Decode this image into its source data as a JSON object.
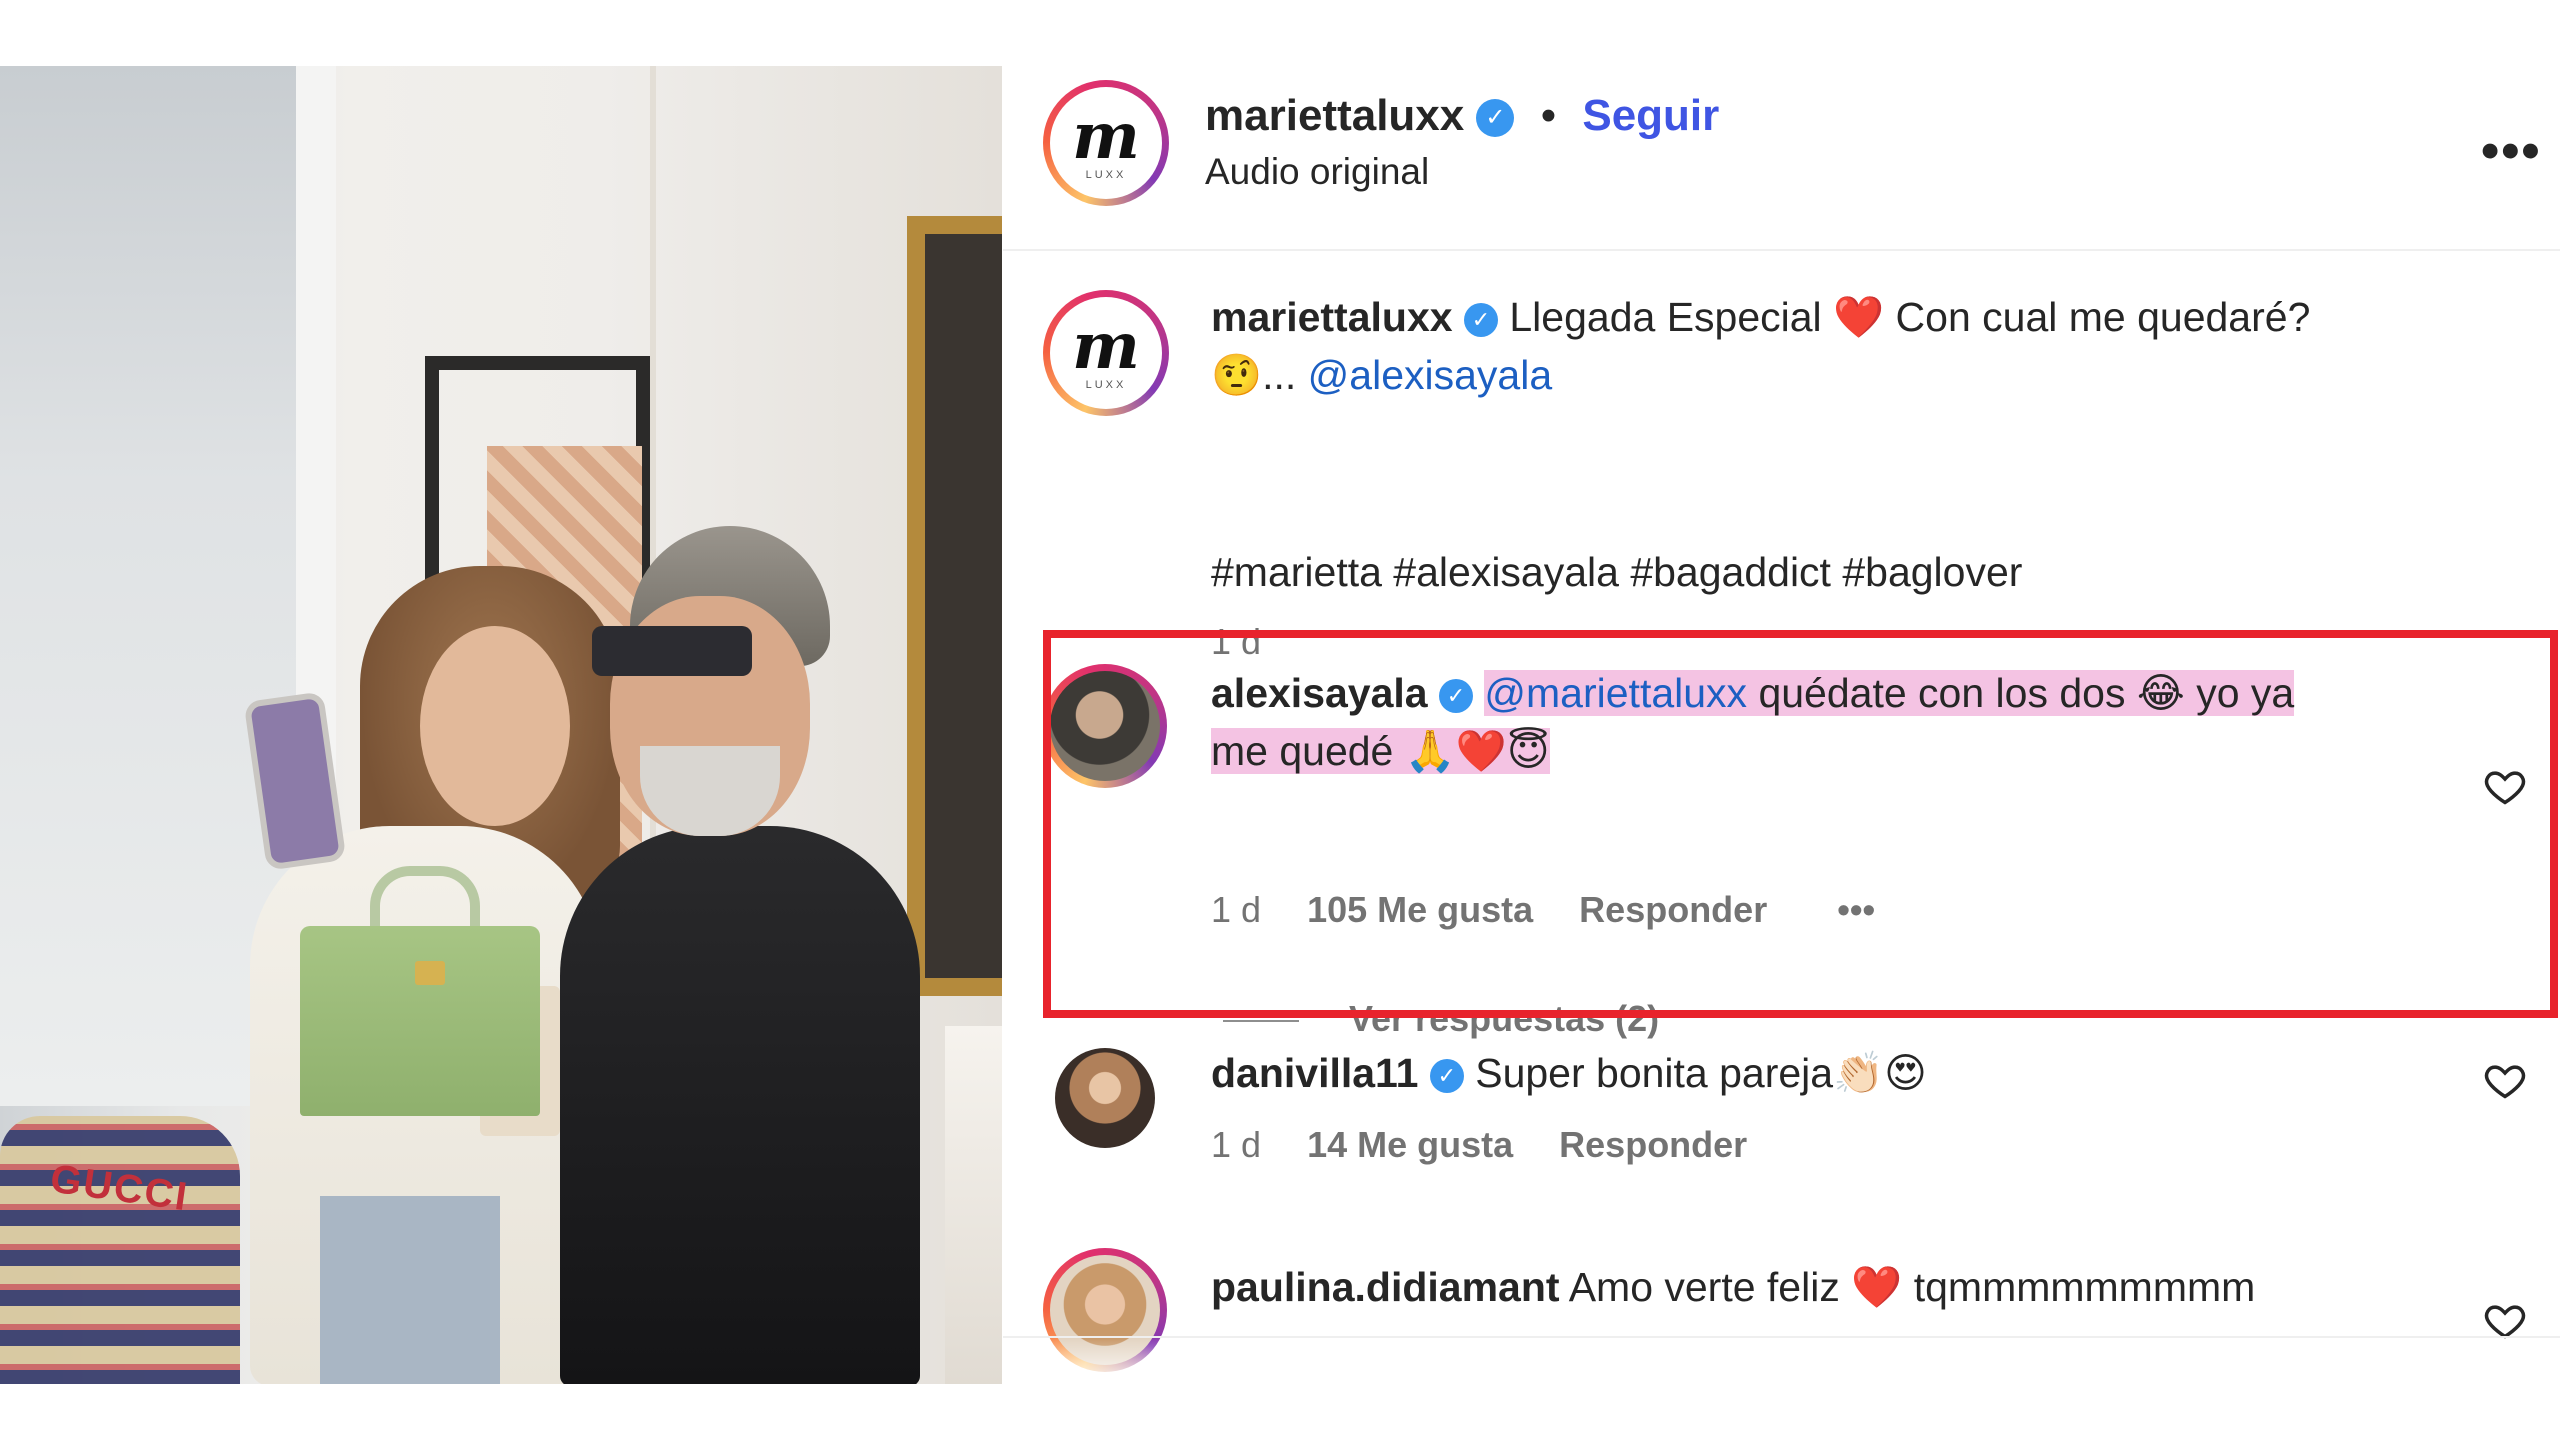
{
  "colors": {
    "verified": "#3897f0",
    "follow": "#3f55e3",
    "hashtag": "#1c5fc2",
    "highlight_border": "#e8232c",
    "mention_highlight": "#f4c3e3",
    "muted": "#737373"
  },
  "photo": {
    "cushion_text": "GUCCI"
  },
  "header": {
    "logo_text": "m",
    "logo_sub": "LUXX",
    "username": "mariettaluxx",
    "separator": "•",
    "follow_label": "Seguir",
    "audio_label": "Audio original",
    "more_icon": "more-horizontal-icon"
  },
  "caption": {
    "username": "mariettaluxx",
    "text_part1": "Llegada Especial",
    "emoji_heart": "❤️",
    "text_part2": "Con cual me quedaré?",
    "emoji_eyebrow": "🤨",
    "ellipsis": "...",
    "mention": "@alexisayala",
    "hashtags": "#marietta #alexisayala #bagaddict #baglover",
    "time": "1 d"
  },
  "comments": [
    {
      "username": "alexisayala",
      "mention": "@mariettaluxx",
      "text_a": "quédate con los dos",
      "emoji_a": "😂",
      "text_b": "yo ya",
      "text_c": "me quedé",
      "emoji_c": "🙏❤️😇",
      "time": "1 d",
      "likes": "105 Me gusta",
      "reply_label": "Responder",
      "more": "•••",
      "view_replies": "Ver respuestas (2)"
    },
    {
      "username": "danivilla11",
      "text": "Super bonita pareja",
      "emoji": "👏🏻😍",
      "time": "1 d",
      "likes": "14 Me gusta",
      "reply_label": "Responder"
    },
    {
      "username": "paulina.didiamant",
      "text": "Amo verte feliz",
      "emoji": "❤️",
      "text_after": "tqmmmmmmmmm"
    }
  ]
}
